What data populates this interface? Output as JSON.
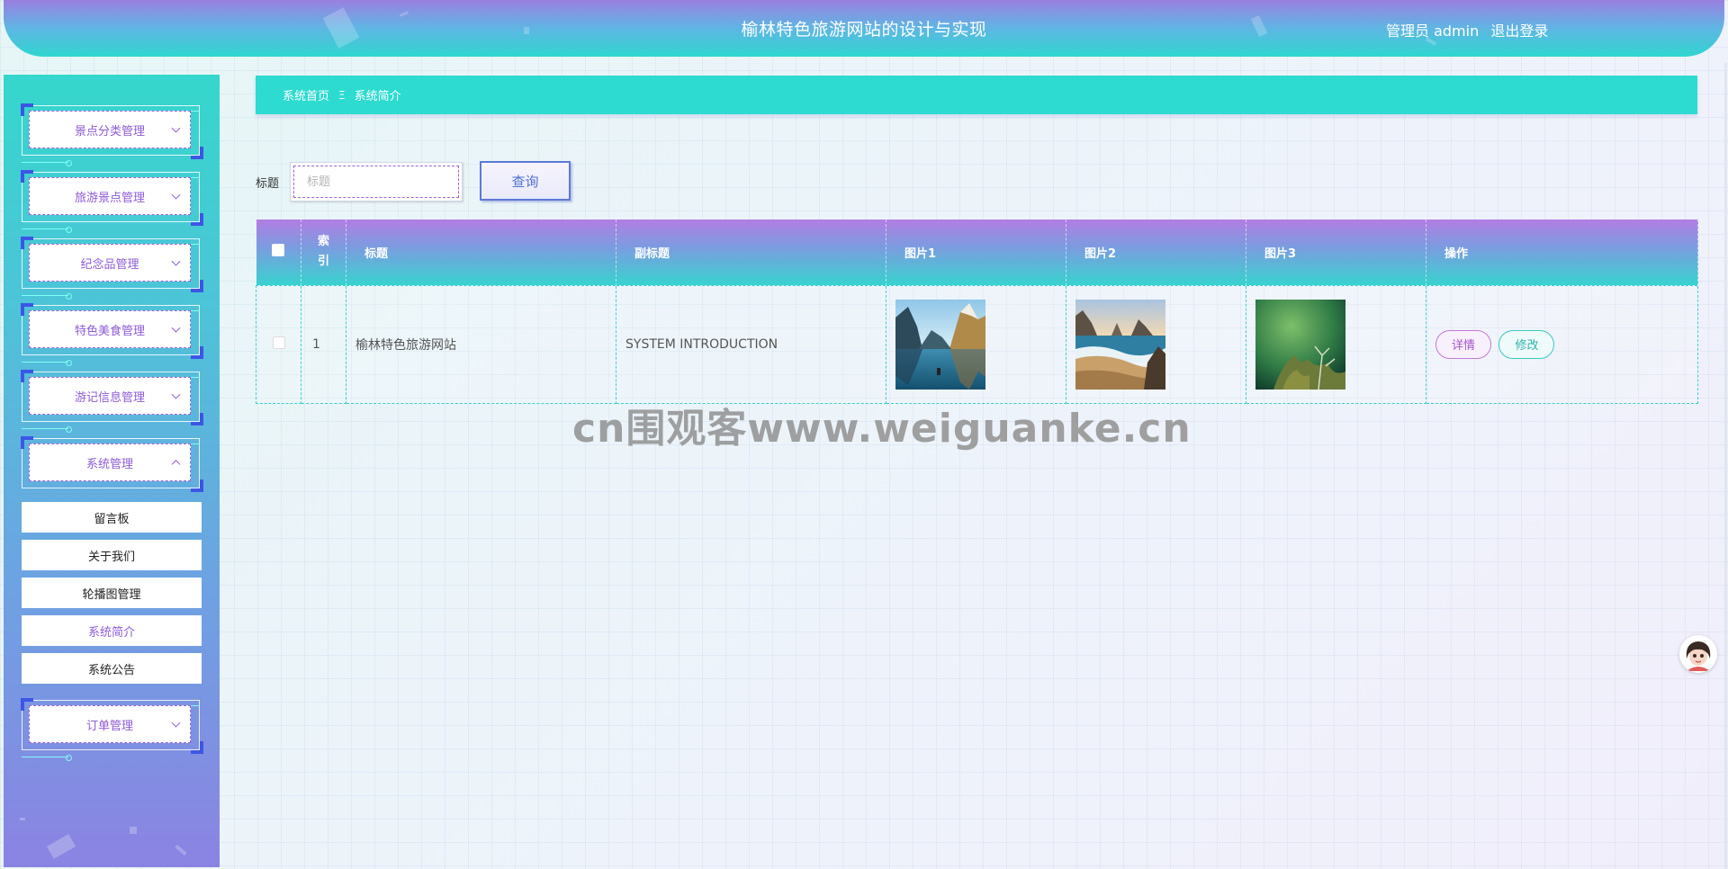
{
  "header": {
    "title": "榆林特色旅游网站的设计与实现",
    "user_label": "管理员 admin",
    "logout_label": "退出登录"
  },
  "sidebar": {
    "groups": [
      {
        "label": "景点分类管理",
        "expanded": false
      },
      {
        "label": "旅游景点管理",
        "expanded": false
      },
      {
        "label": "纪念品管理",
        "expanded": false
      },
      {
        "label": "特色美食管理",
        "expanded": false
      },
      {
        "label": "游记信息管理",
        "expanded": false
      },
      {
        "label": "系统管理",
        "expanded": true
      },
      {
        "label": "订单管理",
        "expanded": false
      }
    ],
    "submenu": [
      {
        "label": "留言板"
      },
      {
        "label": "关于我们"
      },
      {
        "label": "轮播图管理"
      },
      {
        "label": "系统简介",
        "active": true
      },
      {
        "label": "系统公告"
      }
    ]
  },
  "breadcrumb": {
    "home": "系统首页",
    "separator": "Ξ",
    "current": "系统简介"
  },
  "search": {
    "label": "标题",
    "placeholder": "标题",
    "value": "",
    "button_label": "查询"
  },
  "table": {
    "columns": [
      "",
      "索引",
      "标题",
      "副标题",
      "图片1",
      "图片2",
      "图片3",
      "操作"
    ],
    "rows": [
      {
        "index": "1",
        "title": "榆林特色旅游网站",
        "subtitle": "SYSTEM INTRODUCTION",
        "images": [
          "mountain-lake-photo",
          "coastal-sea-photo",
          "green-plant-photo"
        ],
        "actions": {
          "detail": "详情",
          "edit": "修改"
        }
      }
    ]
  },
  "watermark": "cn围观客www.weiguanke.cn",
  "colors": {
    "accent_teal": "#2ddbd0",
    "accent_purple": "#8d5bd6",
    "frame_blue": "#3c56e6"
  }
}
